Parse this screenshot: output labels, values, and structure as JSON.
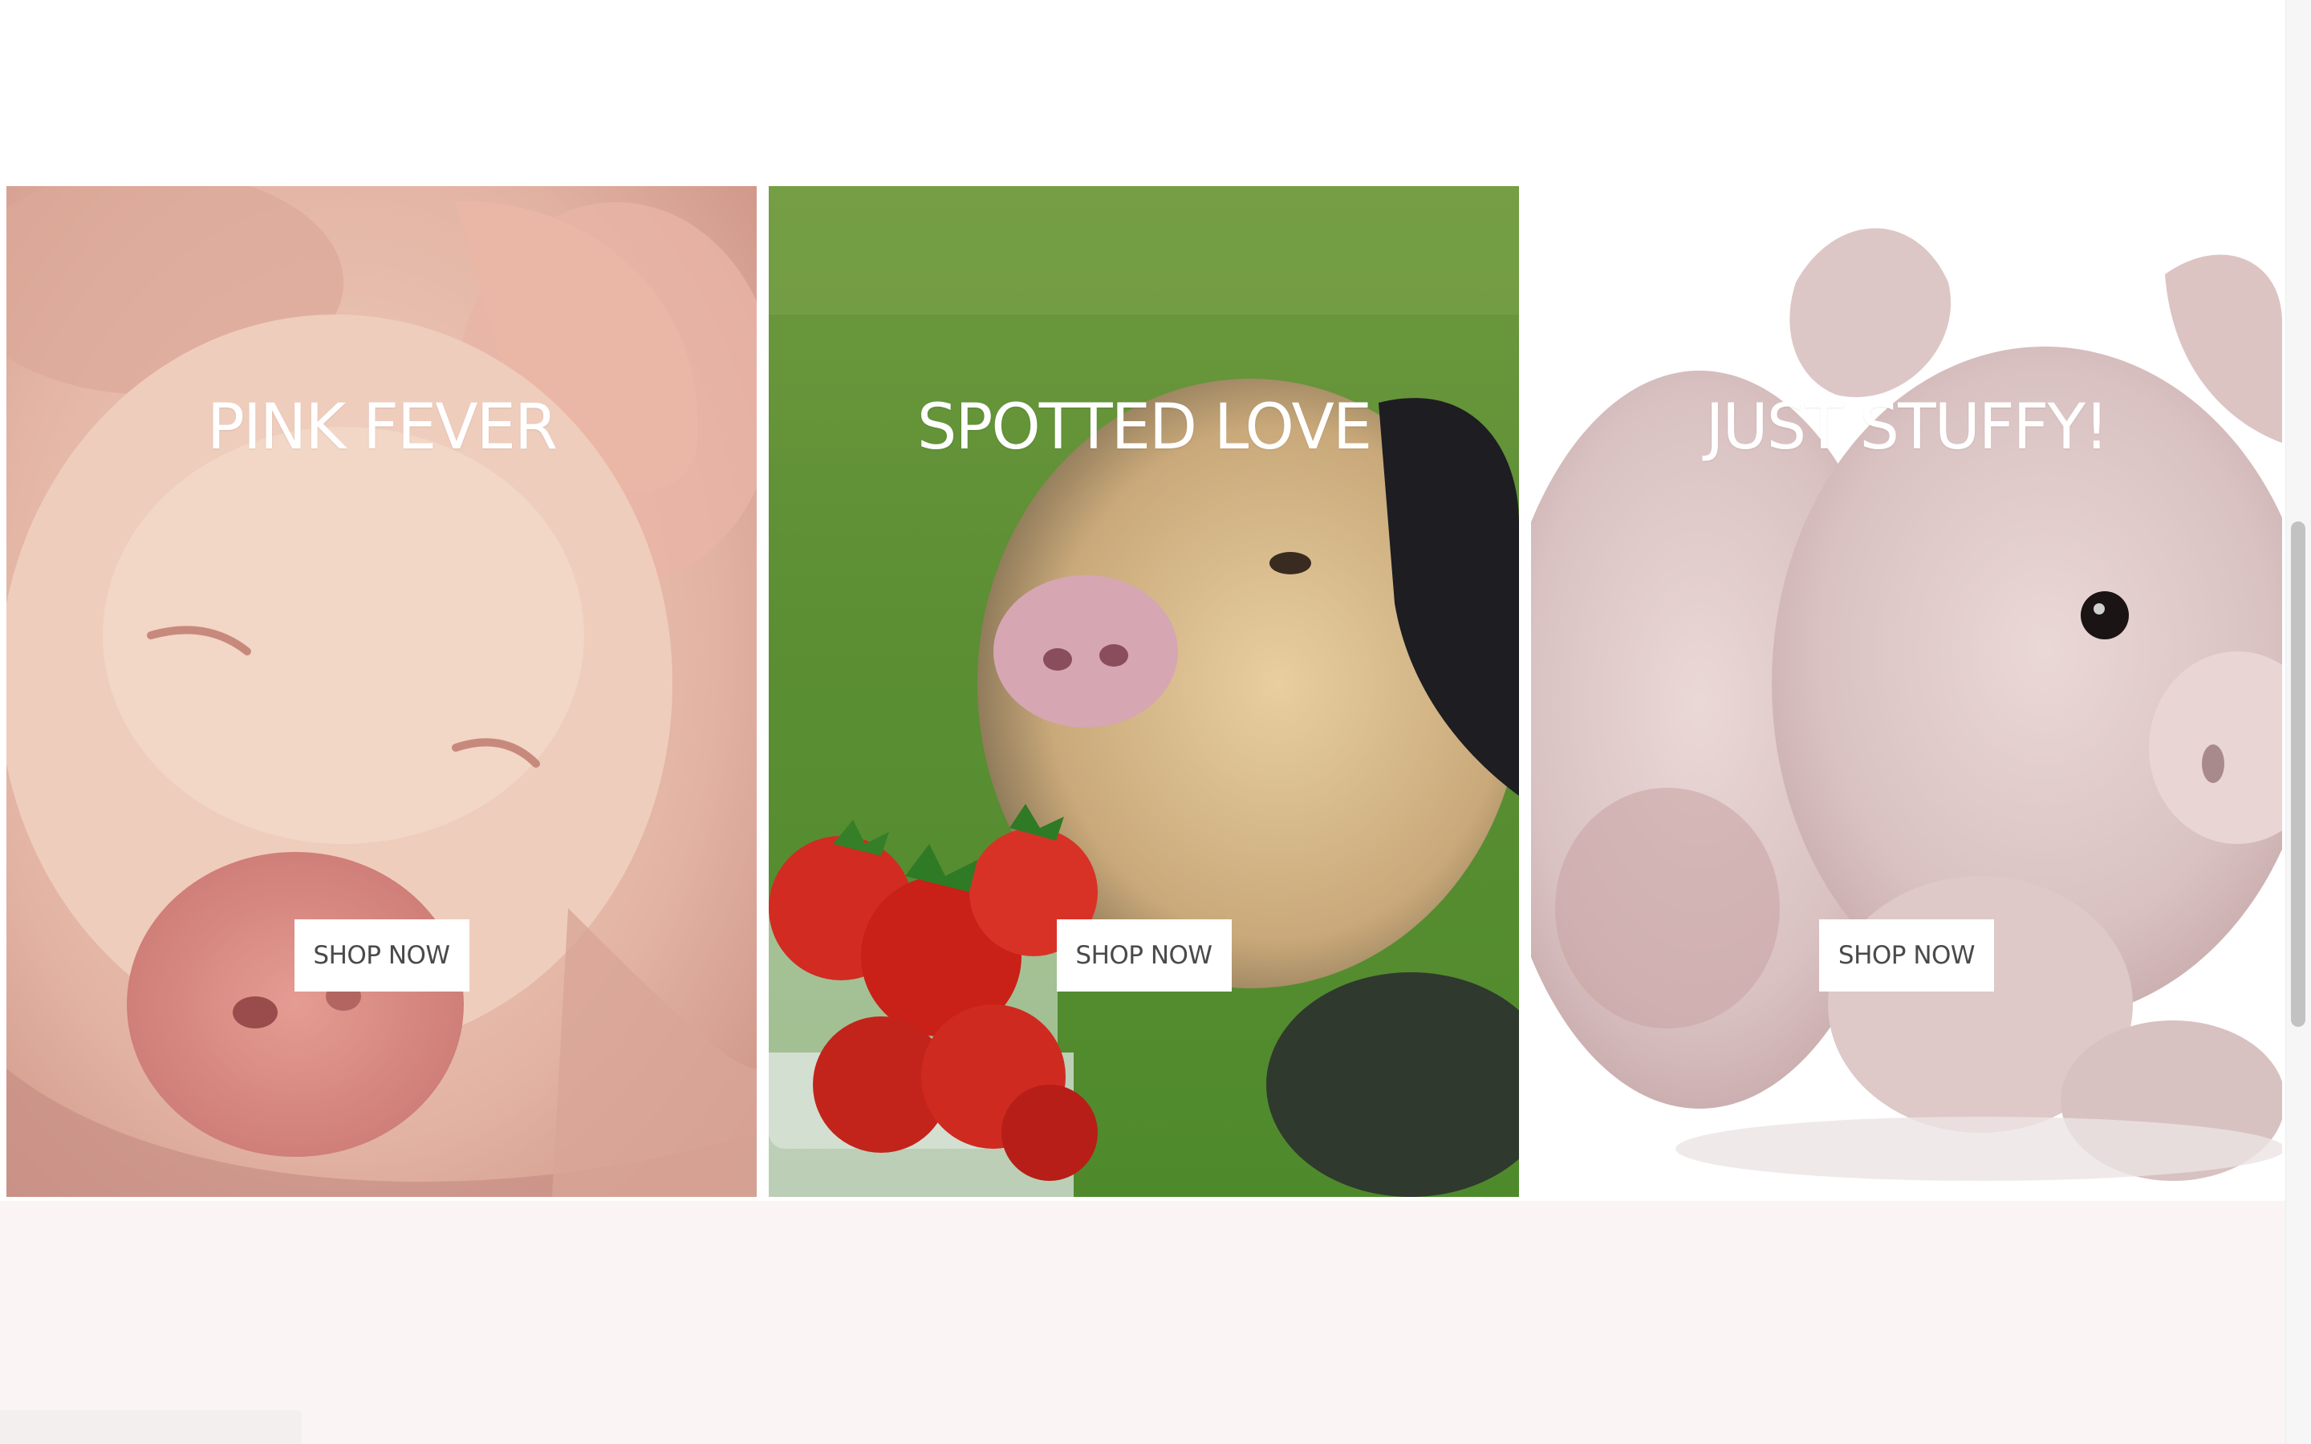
{
  "gallery": {
    "cards": [
      {
        "title": "PINK FEVER",
        "button_label": "SHOP NOW"
      },
      {
        "title": "SPOTTED LOVE",
        "button_label": "SHOP NOW"
      },
      {
        "title": "JUST STUFFY!",
        "button_label": "SHOP NOW"
      }
    ]
  },
  "colors": {
    "button_bg": "#ffffff",
    "button_text": "#4a4a4a",
    "title_text": "#ffffff",
    "lower_band": "#faf4f4"
  }
}
